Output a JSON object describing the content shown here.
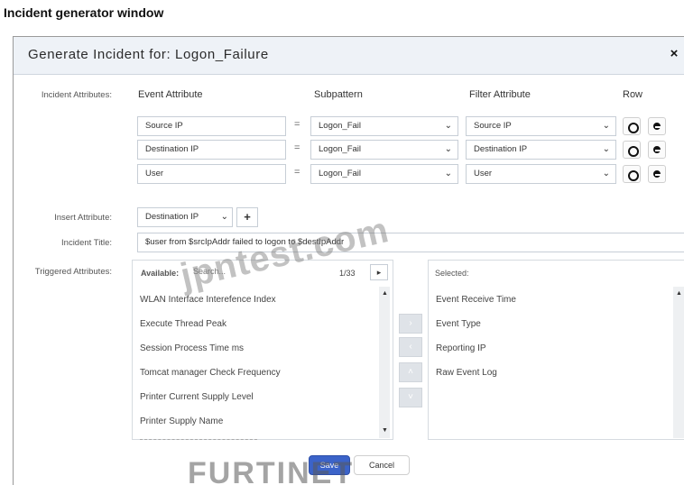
{
  "caption": "Incident generator window",
  "dialog": {
    "title": "Generate Incident for: Logon_Failure",
    "close": "×"
  },
  "incident_attributes": {
    "label": "Incident Attributes:",
    "headers": {
      "event": "Event Attribute",
      "subpattern": "Subpattern",
      "filter": "Filter Attribute",
      "row": "Row"
    },
    "rows": [
      {
        "event": "Source IP",
        "eq": "=",
        "subpattern": "Logon_Fail",
        "filter": "Source IP"
      },
      {
        "event": "Destination IP",
        "eq": "=",
        "subpattern": "Logon_Fail",
        "filter": "Destination IP"
      },
      {
        "event": "User",
        "eq": "=",
        "subpattern": "Logon_Fail",
        "filter": "User"
      }
    ]
  },
  "insert_attribute": {
    "label": "Insert Attribute:",
    "value": "Destination IP",
    "add": "+"
  },
  "incident_title": {
    "label": "Incident Title:",
    "value": "$user from $srcIpAddr failed to logon to $destIpAddr"
  },
  "triggered": {
    "label": "Triggered Attributes:",
    "available_label": "Available:",
    "search_placeholder": "Search...",
    "page": "1/33",
    "available": [
      "WLAN Interface Interefence Index",
      "Execute Thread Peak",
      "Session Process Time ms",
      "Tomcat manager Check Frequency",
      "Printer Current Supply Level",
      "Printer Supply Name"
    ],
    "selected_label": "Selected:",
    "selected": [
      "Event Receive Time",
      "Event Type",
      "Reporting IP",
      "Raw Event Log"
    ]
  },
  "buttons": {
    "save": "Save",
    "cancel": "Cancel"
  },
  "watermarks": {
    "site": "jpntest.com",
    "brand": "FURTINET"
  },
  "colors": {
    "header_bg": "#eef2f7",
    "save_blue": "#3b63c9"
  }
}
